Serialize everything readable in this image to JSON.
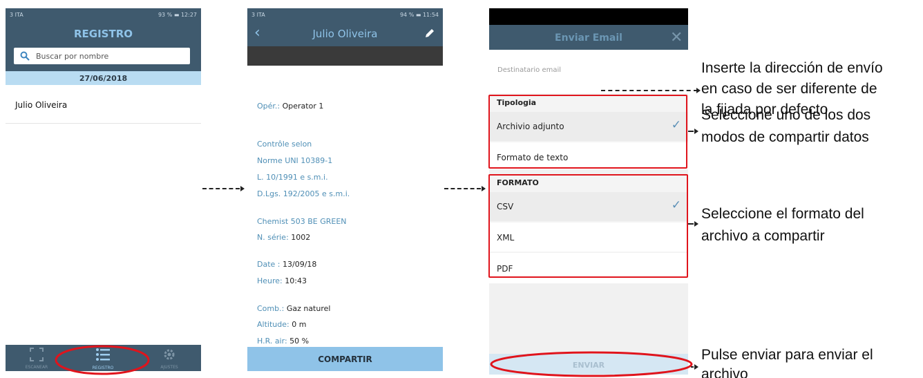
{
  "phone1": {
    "status_left": "3 ITA",
    "status_right": "93 % ▬ 12:27",
    "title": "REGISTRO",
    "search_placeholder": "Buscar por nombre",
    "date_header": "27/06/2018",
    "list_items": [
      "Julio Oliveira"
    ],
    "tabs": [
      "ESCANEAR",
      "REGISTRO",
      "AJUSTES"
    ]
  },
  "phone2": {
    "status_left": "3 ITA",
    "status_right": "94 % ▬ 11:54",
    "back_glyph": "‹",
    "title": "Julio Oliveira",
    "oper_label": "Opér.:",
    "oper_value": "Operator 1",
    "controle": "Contrôle selon",
    "norme": "Norme UNI 10389-1",
    "loi": "L. 10/1991 e s.m.i.",
    "dlgs": "D.Lgs. 192/2005 e s.m.i.",
    "device": "Chemist 503 BE GREEN",
    "serie_label": "N. série:",
    "serie_value": "1002",
    "date_label": "Date :",
    "date_value": "13/09/18",
    "heure_label": "Heure:",
    "heure_value": "10:43",
    "comb_label": "Comb.:",
    "comb_value": "Gaz naturel",
    "alt_label": "Altitude:",
    "alt_value": "0 m",
    "hr_label": "H.R. air:",
    "hr_value": "50 %",
    "share_button": "COMPARTIR"
  },
  "phone3": {
    "title": "Enviar Email",
    "close_glyph": "✕",
    "recipient_placeholder": "Destinatario email",
    "tipologia_header": "Tipologia",
    "tipologia_options": [
      "Archivio adjunto",
      "Formato de texto"
    ],
    "formato_header": "FORMATO",
    "formato_options": [
      "CSV",
      "XML",
      "PDF"
    ],
    "check_glyph": "✓",
    "send_button": "ENVIAR"
  },
  "annotations": {
    "recipient_line1": "Inserte la dirección de envío",
    "recipient_line2": "en caso de ser diferente de",
    "recipient_line3": "la fijada por defecto",
    "mode_line1": "Seleccione uno de los dos",
    "mode_line2": "modos de compartir datos",
    "format_line1": "Seleccione el formato del",
    "format_line2": "archivo a compartir",
    "send_line1": "Pulse enviar para enviar el",
    "send_line2": "archivo"
  },
  "colors": {
    "header_dark": "#3f5a6e",
    "accent_light_blue": "#8fc3e8",
    "highlight_red": "#e0141c"
  }
}
